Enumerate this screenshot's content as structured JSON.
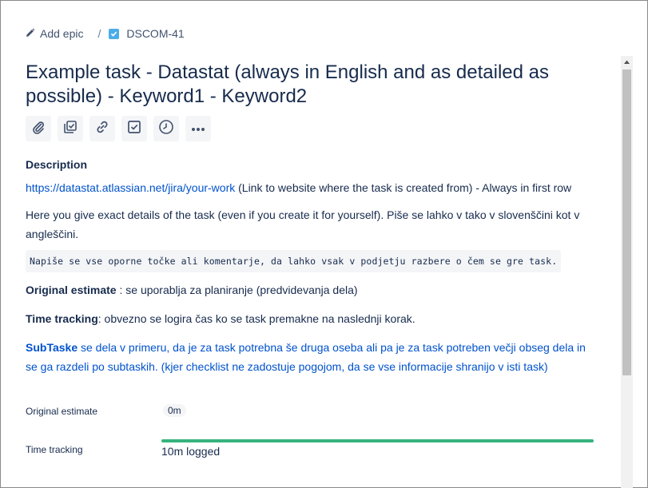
{
  "breadcrumb": {
    "add_epic": "Add epic",
    "separator": "/",
    "issue_key": "DSCOM-41"
  },
  "issue": {
    "title": "Example task - Datastat (always in English and as detailed as possible) - Keyword1 - Keyword2"
  },
  "toolbar": {
    "icons": [
      "attachment-icon",
      "child-issue-icon",
      "link-icon",
      "checklist-icon",
      "clock-icon",
      "more-icon"
    ]
  },
  "description": {
    "label": "Description",
    "link_text": "https://datastat.atlassian.net/jira/your-work",
    "link_suffix": " (Link to website where the task is created from) - Always in first row",
    "paragraph2": "Here you give exact details of the task (even if you create it for yourself). Piše se lahko v tako v slovenščini kot v angleščini.",
    "code_line": "Napiše se vse oporne točke ali komentarje, da lahko vsak v podjetju razbere o čem se gre task.",
    "orig_est_bold": "Original estimate",
    "orig_est_rest": " : se uporablja za planiranje (predvidevanja dela)",
    "time_tracking_bold": "Time tracking",
    "time_tracking_rest": ": obvezno se logira čas ko se task premakne na naslednji korak.",
    "subtasks_bold": "SubTaske",
    "subtasks_rest": " se dela v primeru, da je za task potrebna še druga oseba ali pa je za task potreben večji obseg dela in se ga razdeli po subtaskih. (kjer checklist ne zadostuje pogojom, da se vse informacije shranijo v isti task)"
  },
  "fields": {
    "original_estimate_label": "Original estimate",
    "original_estimate_value": "0m",
    "time_tracking_label": "Time tracking",
    "time_tracking_value": "10m logged",
    "time_tracking_progress": 1.0
  },
  "colors": {
    "link": "#0052cc",
    "progress": "#36b37e",
    "issue_type": "#4bade8"
  }
}
